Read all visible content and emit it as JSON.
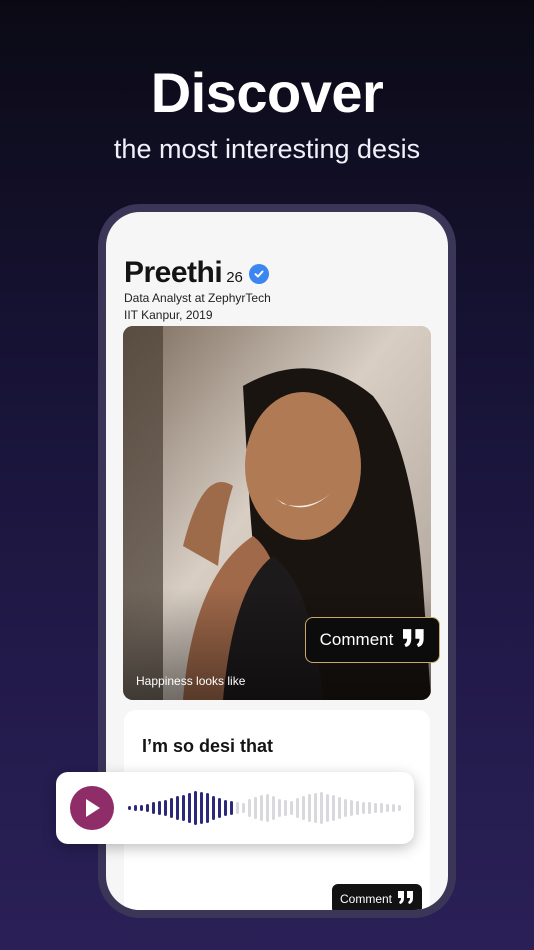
{
  "headline": "Discover",
  "subheadline": "the most interesting desis",
  "profile": {
    "name": "Preethi",
    "age": "26",
    "job": "Data Analyst at ZephyrTech",
    "school": "IIT Kanpur, 2019",
    "photo_caption": "Happiness looks like"
  },
  "comment_button_label": "Comment",
  "prompt": {
    "title": "I’m so desi that",
    "comment_label": "Comment"
  },
  "voice_note": {
    "played_fraction": 0.4
  },
  "colors": {
    "play": "#8e2d67",
    "wave_played": "#2c2a78",
    "wave_unplayed": "#d9d9dd"
  }
}
